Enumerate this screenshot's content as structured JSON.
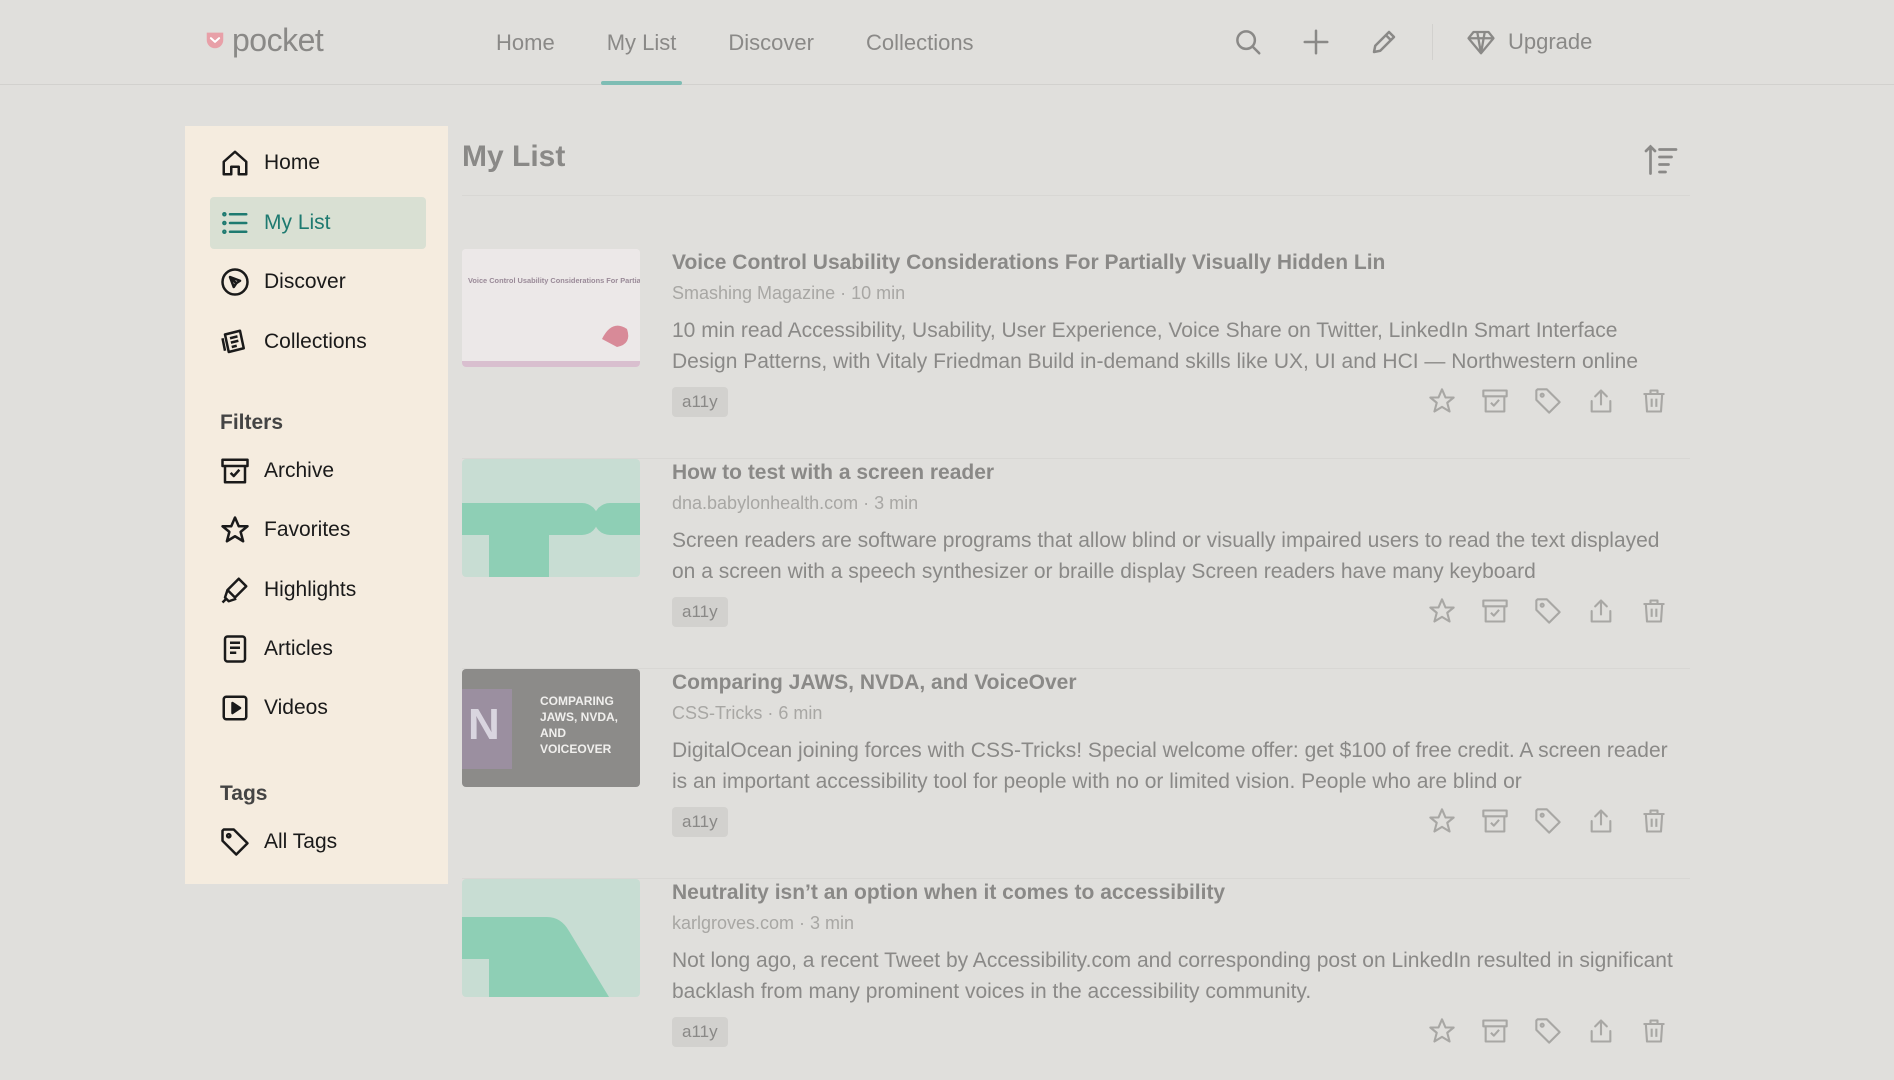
{
  "app": {
    "logo_text": "pocket"
  },
  "topnav": [
    {
      "label": "Home"
    },
    {
      "label": "My List",
      "active": true
    },
    {
      "label": "Discover"
    },
    {
      "label": "Collections"
    }
  ],
  "toolbar": {
    "search_icon": "search-icon",
    "add_icon": "plus-icon",
    "highlight_icon": "pencil-icon",
    "upgrade_label": "Upgrade"
  },
  "sidebar": {
    "nav": [
      {
        "label": "Home",
        "icon": "home-icon"
      },
      {
        "label": "My List",
        "icon": "list-icon",
        "active": true
      },
      {
        "label": "Discover",
        "icon": "compass-icon"
      },
      {
        "label": "Collections",
        "icon": "collections-icon"
      }
    ],
    "filters_heading": "Filters",
    "filters": [
      {
        "label": "Archive",
        "icon": "archive-icon"
      },
      {
        "label": "Favorites",
        "icon": "star-icon"
      },
      {
        "label": "Highlights",
        "icon": "highlighter-icon"
      },
      {
        "label": "Articles",
        "icon": "article-icon"
      },
      {
        "label": "Videos",
        "icon": "video-icon"
      }
    ],
    "tags_heading": "Tags",
    "tags": [
      {
        "label": "All Tags",
        "icon": "tag-icon"
      }
    ]
  },
  "main": {
    "title": "My List",
    "items": [
      {
        "title": "Voice Control Usability Considerations For Partially Visually Hidden Lin",
        "meta": "Smashing Magazine · 10 min",
        "excerpt": "10 min read Accessibility, Usability, User Experience, Voice Share on Twitter, LinkedIn Smart Interface Design Patterns, with Vitaly Friedman Build in-demand skills like UX, UI and HCI — Northwestern online",
        "tag": "a11y",
        "thumb_title": "Voice Control Usability Considerations For Partially Visually Hidden Link Names"
      },
      {
        "title": "How to test with a screen reader",
        "meta": "dna.babylonhealth.com · 3 min",
        "excerpt": "Screen readers are software programs that allow blind or visually impaired users to read the text displayed on a screen with a speech synthesizer or braille display Screen readers have many keyboard",
        "tag": "a11y"
      },
      {
        "title": "Comparing JAWS, NVDA, and VoiceOver",
        "meta": "CSS-Tricks · 6 min",
        "excerpt": "DigitalOcean joining forces with CSS-Tricks! Special welcome offer: get $100 of free credit. A screen reader is an important accessibility tool for people with no or limited vision. People who are blind or",
        "tag": "a11y",
        "thumb_text": "COMPARING JAWS, NVDA, AND VOICEOVER"
      },
      {
        "title": "Neutrality isn’t an option when it comes to accessibility",
        "meta": "karlgroves.com · 3 min",
        "excerpt": "Not long ago, a recent Tweet by Accessibility.com and corresponding post on LinkedIn resulted in significant backlash from many prominent voices in the accessibility community.",
        "tag": "a11y"
      }
    ]
  },
  "colors": {
    "accent": "#7ebdb4",
    "sidebar_bg": "#f5ecdf",
    "page_bg": "#e0dfdc",
    "active_text": "#1e7a70"
  }
}
